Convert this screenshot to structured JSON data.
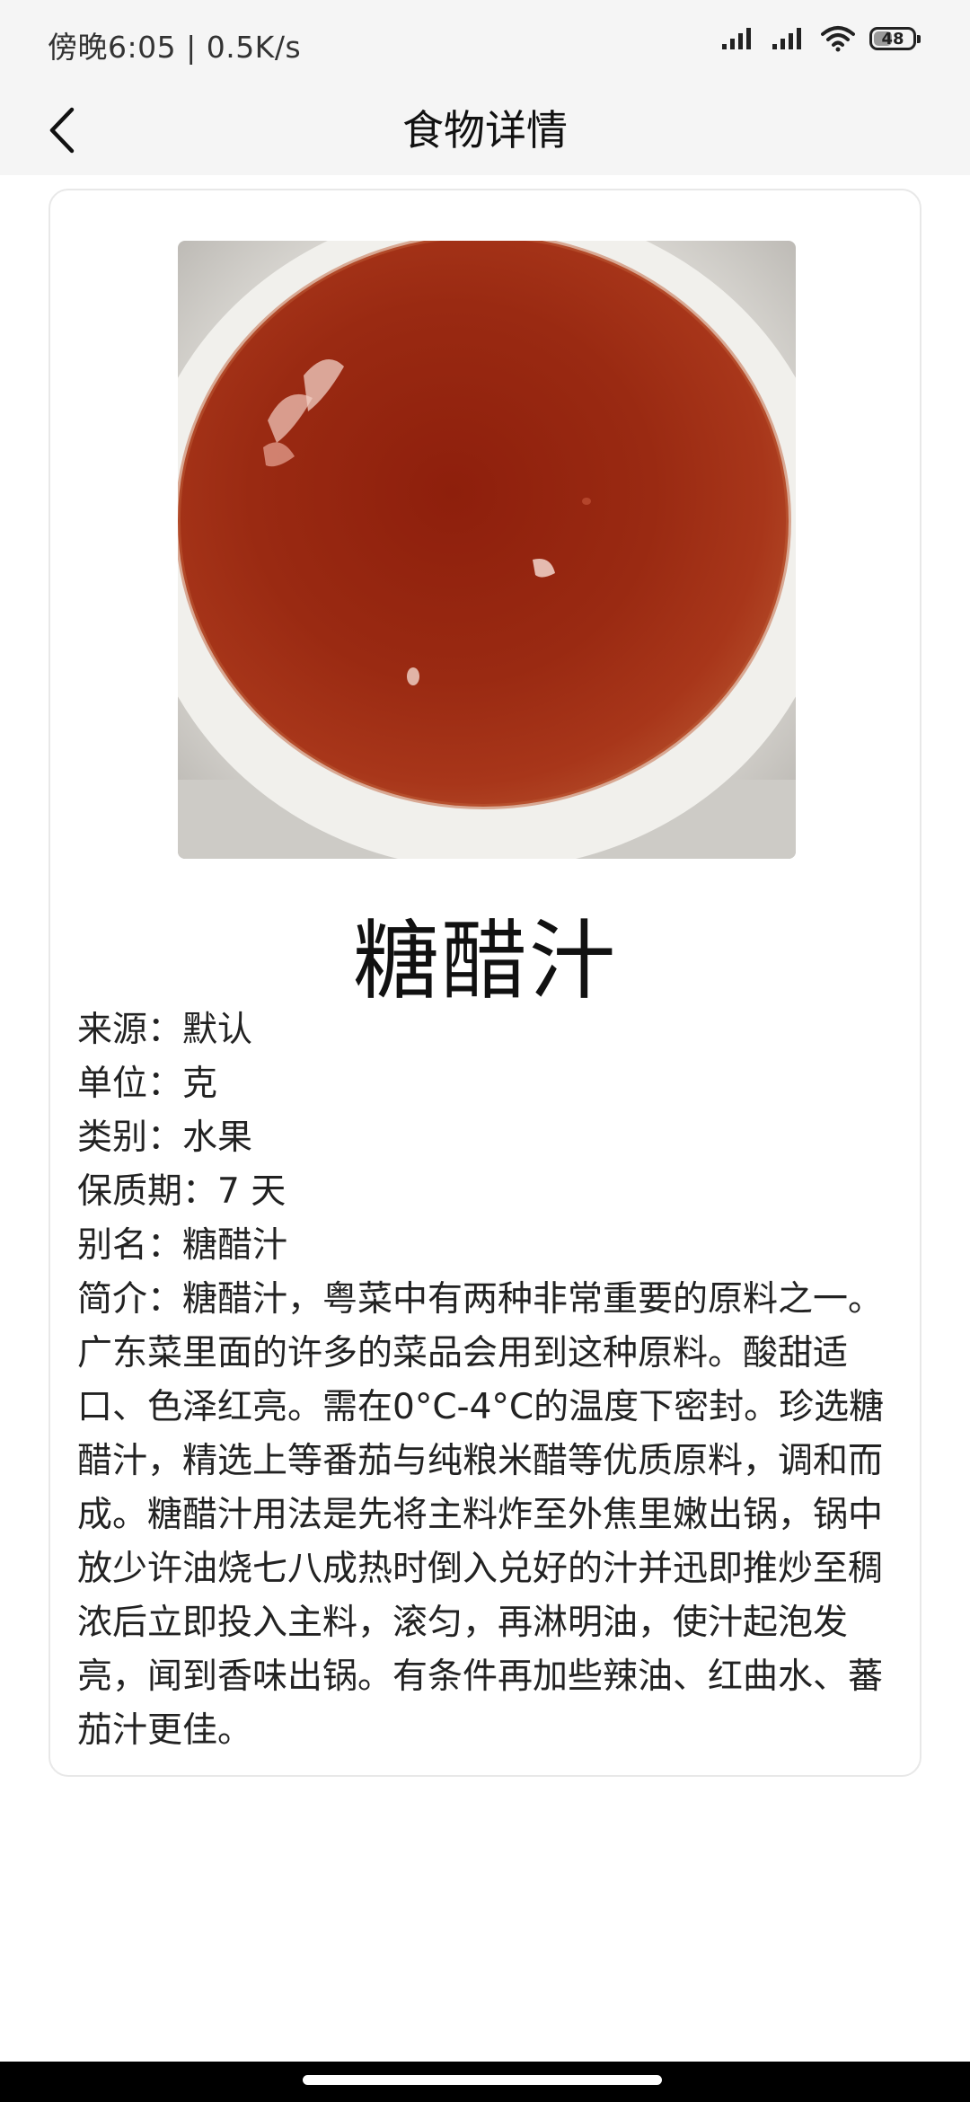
{
  "status_bar": {
    "time_speed": "傍晚6:05 | 0.5K/s",
    "battery": "48",
    "battery_level": 0.48,
    "icons": [
      "signal-icon",
      "signal-icon",
      "wifi-icon",
      "battery-icon"
    ]
  },
  "app_bar": {
    "title": "食物详情",
    "back_icon": "chevron-left-icon"
  },
  "food": {
    "name": "糖醋汁",
    "image": "sweet-and-sour-sauce-bowl-photo",
    "rows": [
      {
        "label": "来源：",
        "value": "默认"
      },
      {
        "label": "单位：",
        "value": "克"
      },
      {
        "label": "类别：",
        "value": "水果"
      },
      {
        "label": "保质期：",
        "value": "7 天"
      },
      {
        "label": "别名：",
        "value": "糖醋汁"
      }
    ],
    "intro_label": "简介：",
    "intro": "糖醋汁，粤菜中有两种非常重要的原料之一。广东菜里面的许多的菜品会用到这种原料。酸甜适口、色泽红亮。需在0°C-4°C的温度下密封。珍选糖醋汁，精选上等番茄与纯粮米醋等优质原料，调和而成。糖醋汁用法是先将主料炸至外焦里嫩出锅，锅中放少许油烧七八成热时倒入兑好的汁并迅即推炒至稠浓后立即投入主料，滚匀，再淋明油，使汁起泡发亮，闻到香味出锅。有条件再加些辣油、红曲水、蕃茄汁更佳。"
  },
  "colors": {
    "bar_background": "#f5f5f5",
    "sauce": "#a8361a",
    "nav_bar": "#000000"
  }
}
